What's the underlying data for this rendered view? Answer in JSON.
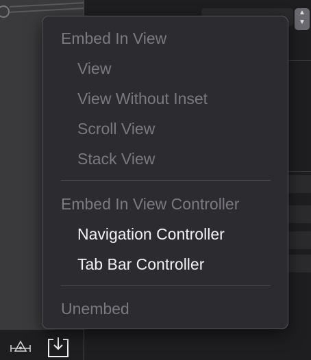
{
  "menu": {
    "embed_in_view": "Embed In View",
    "view": "View",
    "view_without_inset": "View Without Inset",
    "scroll_view": "Scroll View",
    "stack_view": "Stack View",
    "embed_in_view_controller": "Embed In View Controller",
    "navigation_controller": "Navigation Controller",
    "tab_bar_controller": "Tab Bar Controller",
    "unembed": "Unembed"
  },
  "bottom_bar": {
    "icons": [
      "resolve-autolayout-issues-icon",
      "embed-in-icon"
    ]
  },
  "colors": {
    "menu_bg": "#2c2b30",
    "disabled_text": "#7b7a80",
    "enabled_text": "#f2f2f4"
  }
}
